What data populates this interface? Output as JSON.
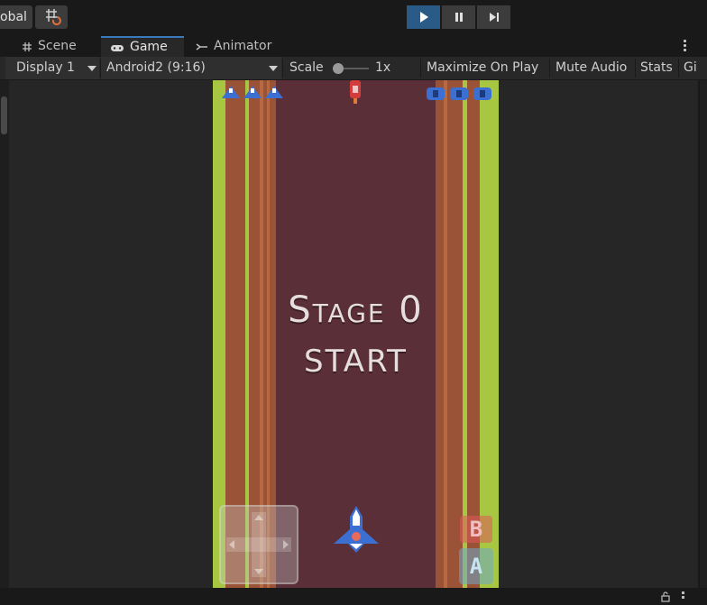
{
  "toolbar": {
    "global_label": "obal",
    "grid_snap_icon": "grid-snap-icon",
    "play_icon": "play-icon",
    "pause_icon": "pause-icon",
    "step_icon": "step-icon"
  },
  "tabs": [
    {
      "label": "Scene",
      "icon": "hash-icon"
    },
    {
      "label": "Game",
      "icon": "gamepad-icon"
    },
    {
      "label": "Animator",
      "icon": "animator-icon"
    }
  ],
  "game_toolbar": {
    "display": "Display 1",
    "aspect": "Android2 (9:16)",
    "scale_label": "Scale",
    "scale_value": "1x",
    "scale_level": 0.0,
    "maximize": "Maximize On Play",
    "mute": "Mute Audio",
    "stats": "Stats",
    "gizmos": "Gi"
  },
  "game": {
    "title": "Stage 0",
    "subtitle": "START",
    "btn_b": "B",
    "btn_a": "A",
    "lives_icons": [
      "life-ship-icon",
      "life-ship-icon",
      "life-ship-icon"
    ],
    "bomb_icons": [
      "bomb-icon",
      "bomb-icon",
      "bomb-icon"
    ]
  },
  "colors": {
    "accent": "#2a5a86",
    "road": "#5b2f38",
    "grass": "#a7c642",
    "dirt": "#9b5337"
  }
}
